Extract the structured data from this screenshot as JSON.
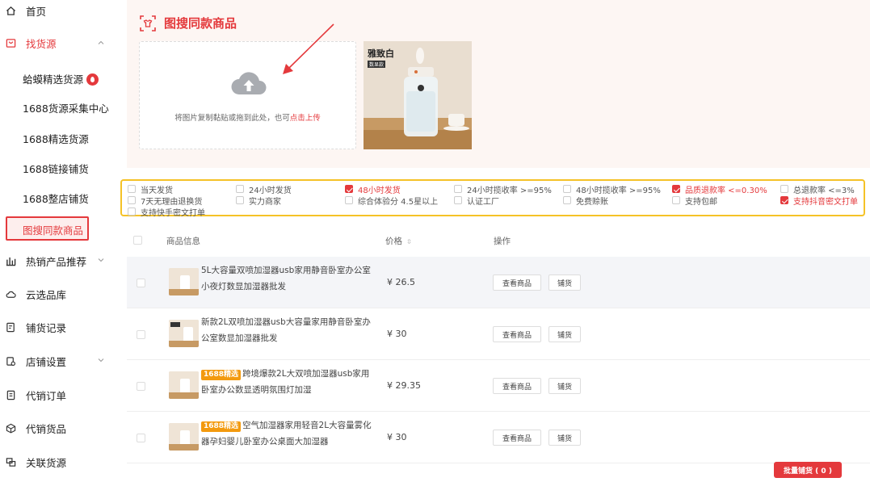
{
  "sidebar": {
    "home": "首页",
    "find_source": "找货源",
    "sub_items": [
      "蛤蟆精选货源",
      "1688货源采集中心",
      "1688精选货源",
      "1688链接铺货",
      "1688整店铺货",
      "图搜同款商品"
    ],
    "hot_products": "热销产品推荐",
    "cloud_library": "云选品库",
    "listing_records": "铺货记录",
    "store_settings": "店铺设置",
    "dropship_orders": "代销订单",
    "dropship_goods": "代销货品",
    "linked_source": "关联货源"
  },
  "header": {
    "title": "图搜同款商品",
    "upload_hint": "将图片复制黏贴或拖到此处，也可",
    "upload_link": "点击上传",
    "preview_text": "雅致白",
    "preview_badge": "数显款"
  },
  "filters": [
    {
      "label": "当天发货",
      "checked": false
    },
    {
      "label": "24小时发货",
      "checked": false
    },
    {
      "label": "48小时发货",
      "checked": true
    },
    {
      "label": "24小时揽收率 >=95%",
      "checked": false
    },
    {
      "label": "48小时揽收率 >=95%",
      "checked": false
    },
    {
      "label": "品质退款率 <=0.30%",
      "checked": true
    },
    {
      "label": "总退款率 <=3%",
      "checked": false
    },
    {
      "label": "7天无理由退换货",
      "checked": false
    },
    {
      "label": "实力商家",
      "checked": false
    },
    {
      "label": "综合体验分 4.5星以上",
      "checked": false
    },
    {
      "label": "认证工厂",
      "checked": false
    },
    {
      "label": "免费赊账",
      "checked": false
    },
    {
      "label": "支持包邮",
      "checked": false
    },
    {
      "label": "支持抖音密文打单",
      "checked": true
    },
    {
      "label": "支持快手密文打单",
      "checked": false
    }
  ],
  "table": {
    "col_info": "商品信息",
    "col_price": "价格",
    "col_ops": "操作",
    "rows": [
      {
        "tag": "",
        "title": "5L大容量双喷加湿器usb家用静音卧室办公室小夜灯数显加湿器批发",
        "price": "¥ 26.5"
      },
      {
        "tag": "",
        "title": "新款2L双喷加湿器usb大容量家用静音卧室办公室数显加湿器批发",
        "price": "¥ 30"
      },
      {
        "tag": "1688精选",
        "title": "跨境爆款2L大双喷加湿器usb家用卧室办公数显透明氛围灯加湿",
        "price": "¥ 29.35"
      },
      {
        "tag": "1688精选",
        "title": "空气加湿器家用轻音2L大容量雾化器孕妇婴儿卧室办公桌面大加湿器",
        "price": "¥ 30"
      }
    ],
    "view_label": "查看商品",
    "list_label": "铺货"
  },
  "batch_button": "批量铺货 ( 0 )",
  "colors": {
    "accent": "#e4393c",
    "filter_border": "#f5c227",
    "tag": "#f39a0f"
  }
}
